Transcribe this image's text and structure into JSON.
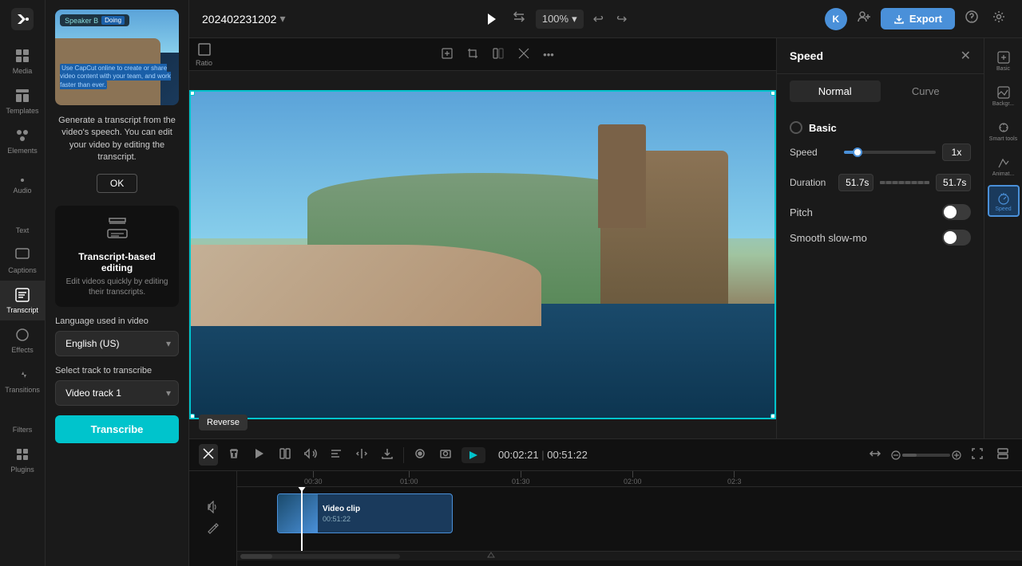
{
  "app": {
    "title": "Transcribe",
    "logo_icon": "capcut-logo"
  },
  "topbar": {
    "project_name": "202402231202",
    "zoom_level": "100%",
    "export_label": "Export",
    "avatar_letter": "K"
  },
  "sidebar": {
    "items": [
      {
        "id": "media",
        "label": "Media",
        "icon": "media-icon"
      },
      {
        "id": "templates",
        "label": "Templates",
        "icon": "templates-icon"
      },
      {
        "id": "elements",
        "label": "Elements",
        "icon": "elements-icon"
      },
      {
        "id": "audio",
        "label": "Audio",
        "icon": "audio-icon"
      },
      {
        "id": "text",
        "label": "Text",
        "icon": "text-icon"
      },
      {
        "id": "captions",
        "label": "Captions",
        "icon": "captions-icon"
      },
      {
        "id": "transcript",
        "label": "Transcript",
        "icon": "transcript-icon",
        "active": true
      },
      {
        "id": "effects",
        "label": "Effects",
        "icon": "effects-icon"
      },
      {
        "id": "transitions",
        "label": "Transitions",
        "icon": "transitions-icon"
      },
      {
        "id": "filters",
        "label": "Filters",
        "icon": "filters-icon"
      },
      {
        "id": "plugins",
        "label": "Plugins",
        "icon": "plugins-icon"
      }
    ]
  },
  "panel": {
    "preview": {
      "badge_speaker": "Speaker B",
      "badge_indicator": "Doing",
      "text": "Use CapCut online to create or share video content with your team, and work faster than ever."
    },
    "desc": "Generate a transcript from the video's speech. You can edit your video by editing the transcript.",
    "ok_label": "OK",
    "transcript_section": {
      "title": "Transcript-based editing",
      "desc": "Edit videos quickly by editing their transcripts."
    },
    "language_label": "Language used in video",
    "language_value": "English (US)",
    "track_label": "Select track to transcribe",
    "track_value": "Video track 1",
    "transcribe_label": "Transcribe"
  },
  "canvas": {
    "ratio_label": "Ratio",
    "more_icon": "more-options-icon"
  },
  "speed_panel": {
    "title": "Speed",
    "close_icon": "close-icon",
    "tabs": [
      {
        "id": "normal",
        "label": "Normal",
        "active": true
      },
      {
        "id": "curve",
        "label": "Curve",
        "active": false
      }
    ],
    "basic_label": "Basic",
    "speed_label": "Speed",
    "speed_value": "1x",
    "duration_label": "Duration",
    "duration_start": "51.7s",
    "duration_end": "51.7s",
    "pitch_label": "Pitch",
    "smooth_label": "Smooth slow-mo"
  },
  "right_sidebar": {
    "items": [
      {
        "id": "basic",
        "label": "Basic",
        "icon": "basic-icon"
      },
      {
        "id": "background",
        "label": "Backgr...",
        "icon": "background-icon"
      },
      {
        "id": "smart-tools",
        "label": "Smart tools",
        "icon": "smart-tools-icon"
      },
      {
        "id": "animate",
        "label": "Animat...",
        "icon": "animate-icon"
      },
      {
        "id": "speed",
        "label": "Speed",
        "icon": "speed-icon",
        "active": true
      }
    ]
  },
  "timeline": {
    "time_current": "00:02:21",
    "time_total": "00:51:22",
    "reverse_tooltip": "Reverse",
    "markers": [
      "00:30",
      "01:00",
      "01:30",
      "02:00",
      "02:3"
    ],
    "clip": {
      "title": "Video clip",
      "duration": "00:51:22"
    }
  }
}
